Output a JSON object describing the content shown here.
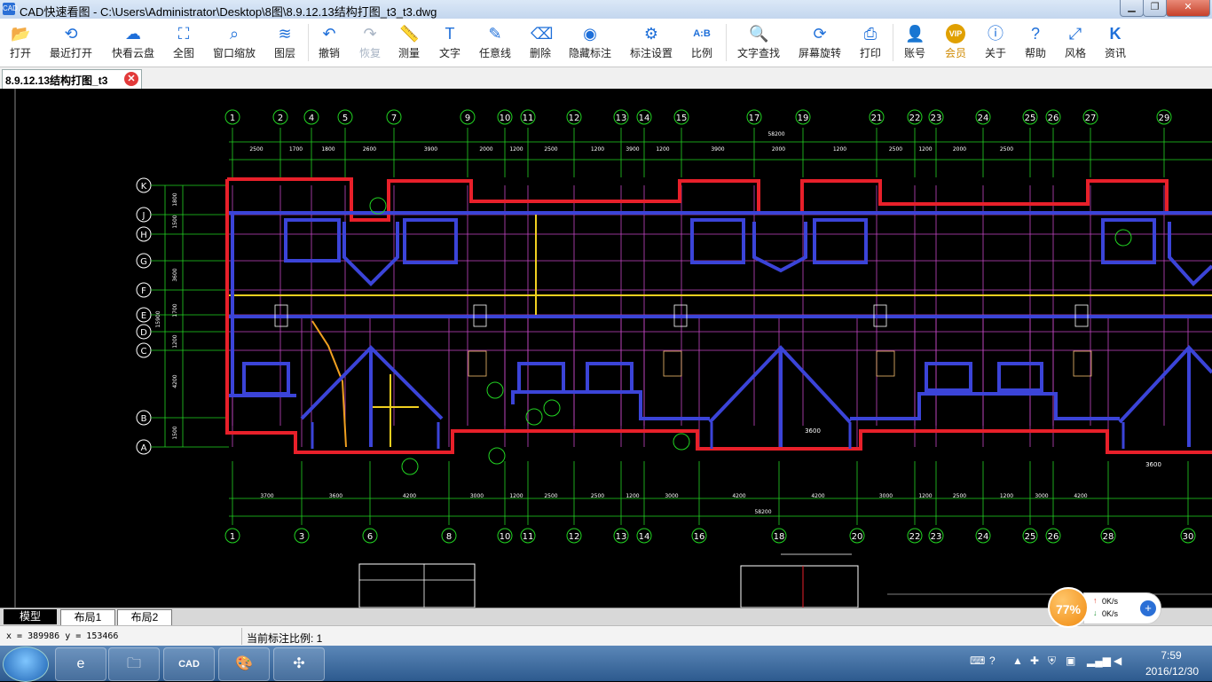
{
  "window": {
    "title": "CAD快速看图 - C:\\Users\\Administrator\\Desktop\\8图\\8.9.12.13结构打图_t3_t3.dwg",
    "app_icon": "CAD",
    "minimize": "▁",
    "maximize": "❐",
    "close": "✕"
  },
  "toolbar": {
    "items": [
      {
        "label": "打开",
        "icon": "📂"
      },
      {
        "label": "最近打开",
        "icon": "⟲"
      },
      {
        "label": "快看云盘",
        "icon": "☁"
      },
      {
        "label": "全图",
        "icon": "⛶"
      },
      {
        "label": "窗口缩放",
        "icon": "⌕"
      },
      {
        "label": "图层",
        "icon": "≋"
      },
      {
        "label": "撤销",
        "icon": "↶"
      },
      {
        "label": "恢复",
        "icon": "↷"
      },
      {
        "label": "测量",
        "icon": "📏"
      },
      {
        "label": "文字",
        "icon": "T"
      },
      {
        "label": "任意线",
        "icon": "✎"
      },
      {
        "label": "删除",
        "icon": "⌫"
      },
      {
        "label": "隐藏标注",
        "icon": "◉"
      },
      {
        "label": "标注设置",
        "icon": "⚙"
      },
      {
        "label": "比例",
        "icon": "A:B"
      },
      {
        "label": "文字查找",
        "icon": "🔍"
      },
      {
        "label": "屏幕旋转",
        "icon": "⟳"
      },
      {
        "label": "打印",
        "icon": "⎙"
      },
      {
        "label": "账号",
        "icon": "👤"
      },
      {
        "label": "会员",
        "icon": "VIP"
      },
      {
        "label": "关于",
        "icon": "ⓘ"
      },
      {
        "label": "帮助",
        "icon": "?"
      },
      {
        "label": "风格",
        "icon": "⤢"
      },
      {
        "label": "资讯",
        "icon": "K"
      }
    ]
  },
  "document_tab": {
    "label": "8.9.12.13结构打图_t3",
    "close": "✕"
  },
  "drawing": {
    "top_axes": [
      "1",
      "2",
      "4",
      "5",
      "7",
      "9",
      "10",
      "11",
      "12",
      "13",
      "14",
      "15",
      "17",
      "19",
      "21",
      "22",
      "23",
      "24",
      "25",
      "26",
      "27",
      "29"
    ],
    "bottom_axes": [
      "1",
      "3",
      "6",
      "8",
      "10",
      "11",
      "12",
      "13",
      "14",
      "16",
      "18",
      "20",
      "22",
      "23",
      "24",
      "25",
      "26",
      "28",
      "30"
    ],
    "row_axes": [
      "K",
      "J",
      "H",
      "G",
      "F",
      "E",
      "D",
      "C",
      "B",
      "A"
    ],
    "top_dims": [
      "2500",
      "1700",
      "1800",
      "2600",
      "3900",
      "2000",
      "1200",
      "2500",
      "1200",
      "3900",
      "1200",
      "3900",
      "2000",
      "1200",
      "2500",
      "1200",
      "2000",
      "2500"
    ],
    "total_dim_top": "58200",
    "bottom_dims": [
      "3700",
      "3600",
      "4200",
      "3000",
      "1200",
      "2500",
      "2500",
      "1200",
      "3000",
      "4200",
      "4200",
      "3000",
      "1200",
      "2500",
      "1200",
      "3000",
      "4200"
    ],
    "total_dim_bottom": "58200",
    "side_dims": [
      "1800",
      "1500",
      "3600",
      "1700",
      "1200",
      "4200",
      "1500"
    ],
    "side_total": "15900",
    "mid_dim": "3600",
    "right_dim": "3600",
    "colors": {
      "background": "#000000",
      "outline_red": "#e8202a",
      "beam_blue": "#3b44d8",
      "grid_green": "#22d422",
      "wall_magenta": "#c447c4",
      "beam_yellow": "#f0d020",
      "text_white": "#ffffff"
    }
  },
  "layout_tabs": [
    "模型",
    "布局1",
    "布局2"
  ],
  "status": {
    "coords": "x = 389986  y = 153466",
    "scale": "当前标注比例: 1"
  },
  "net_widget": {
    "percent": "77%",
    "up": "0K/s",
    "down": "0K/s",
    "up_arrow": "↑",
    "down_arrow": "↓",
    "plus": "+"
  },
  "taskbar": {
    "apps": [
      {
        "name": "ie",
        "icon": "e"
      },
      {
        "name": "explorer",
        "icon": "🗀"
      },
      {
        "name": "cad",
        "icon": "CAD"
      },
      {
        "name": "paint",
        "icon": "🎨"
      },
      {
        "name": "tool",
        "icon": "✣"
      }
    ],
    "time": "7:59",
    "date": "2016/12/30"
  }
}
